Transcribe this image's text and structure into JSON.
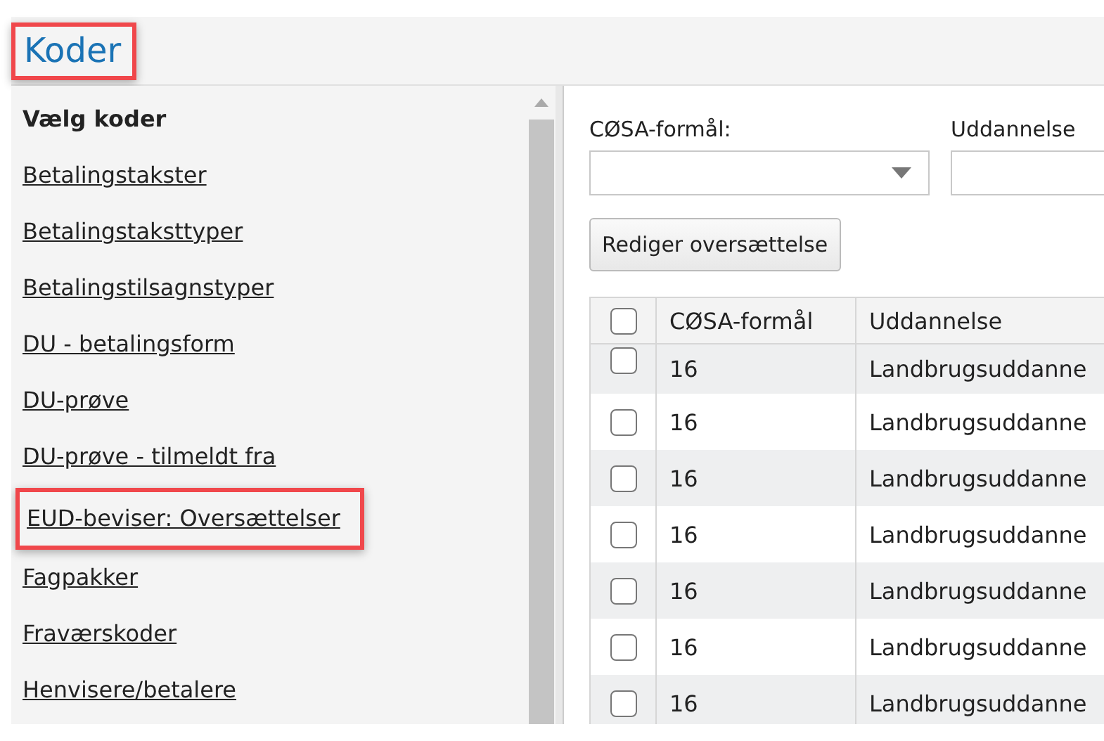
{
  "header": {
    "title": "Koder",
    "highlighted": true
  },
  "sidebar": {
    "heading": "Vælg koder",
    "items": [
      {
        "label": "Betalingstakster",
        "highlighted": false
      },
      {
        "label": "Betalingstaksttyper",
        "highlighted": false
      },
      {
        "label": "Betalingstilsagnstyper",
        "highlighted": false
      },
      {
        "label": "DU - betalingsform",
        "highlighted": false
      },
      {
        "label": "DU-prøve",
        "highlighted": false
      },
      {
        "label": "DU-prøve - tilmeldt fra",
        "highlighted": false
      },
      {
        "label": "EUD-beviser: Oversættelser",
        "highlighted": true
      },
      {
        "label": "Fagpakker",
        "highlighted": false
      },
      {
        "label": "Fraværskoder",
        "highlighted": false
      },
      {
        "label": "Henvisere/betalere",
        "highlighted": false
      }
    ]
  },
  "filters": [
    {
      "label": "CØSA-formål:",
      "kind": "select"
    },
    {
      "label": "Uddannelse",
      "kind": "text"
    }
  ],
  "button": "Rediger oversættelse",
  "table": {
    "header_checked": false,
    "columns": [
      "CØSA-formål",
      "Uddannelse"
    ],
    "rows": [
      {
        "checked": false,
        "cells": [
          "16",
          "Landbrugsuddanne"
        ]
      },
      {
        "checked": false,
        "cells": [
          "16",
          "Landbrugsuddanne"
        ]
      },
      {
        "checked": false,
        "cells": [
          "16",
          "Landbrugsuddanne"
        ]
      },
      {
        "checked": false,
        "cells": [
          "16",
          "Landbrugsuddanne"
        ]
      },
      {
        "checked": false,
        "cells": [
          "16",
          "Landbrugsuddanne"
        ]
      },
      {
        "checked": false,
        "cells": [
          "16",
          "Landbrugsuddanne"
        ]
      },
      {
        "checked": false,
        "cells": [
          "16",
          "Landbrugsuddanne"
        ]
      }
    ]
  }
}
